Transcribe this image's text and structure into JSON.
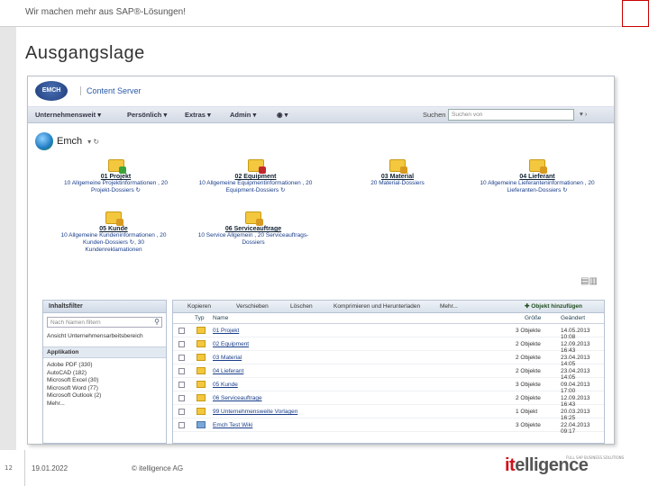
{
  "slide": {
    "tagline": "Wir machen mehr aus SAP®-Lösungen!",
    "title": "Ausgangslage"
  },
  "app": {
    "logo_text": "EMCH",
    "title": "Content Server",
    "menu": [
      "Unternehmensweit",
      "Persönlich",
      "Extras",
      "Admin"
    ],
    "menu_arrows": [
      "▾",
      "▾",
      "▾",
      "▾"
    ],
    "help_icon": "◉ ▾",
    "search_label": "Suchen",
    "search_placeholder": "Suchen von",
    "search_nav": "▾ ›"
  },
  "breadcrumb": {
    "label": "Emch",
    "arrows": "▾ ↻"
  },
  "folders": [
    {
      "name": "01 Projekt",
      "sub": "10 Allgemeine Projektinformationen , 20 Projekt-Dossiers ↻",
      "color": "#3aa33a"
    },
    {
      "name": "02 Equipment",
      "sub": "10 Allgemeine Equipmentinformationen , 20 Equipment-Dossiers ↻",
      "color": "#c0272d"
    },
    {
      "name": "03 Material",
      "sub": "20 Material-Dossiers",
      "color": "#d99a20"
    },
    {
      "name": "04 Lieferant",
      "sub": "10 Allgemeine Lieferanteninformationen , 20 Lieferanten-Dossiers ↻",
      "color": "#d99a20"
    },
    {
      "name": "05 Kunde",
      "sub": "10 Allgemeine Kundeninformationen , 20 Kunden-Dossiers ↻, 30 Kundenreklamationen",
      "color": "#d99a20"
    },
    {
      "name": "06 Serviceauftrage",
      "sub": "10 Service Allgemein , 20 Serviceauftrags-Dossiers",
      "color": "#d99a20"
    }
  ],
  "filter_pane": {
    "title": "Inhaltsfilter",
    "placeholder": "Nach Namen filtern",
    "scope": "Ansicht Unternehmensarbeitsbereich",
    "section": "Applikation",
    "apps": [
      "Adobe PDF (330)",
      "AutoCAD (182)",
      "Microsoft Excel (30)",
      "Microsoft Word (77)",
      "Microsoft Outlook (2)"
    ],
    "more": "Mehr..."
  },
  "toolbar": {
    "items": [
      "Kopieren",
      "Verschieben",
      "Löschen",
      "Komprimieren und Herunterladen",
      "Mehr..."
    ],
    "add": "Objekt hinzufügen"
  },
  "grid": {
    "headers": [
      "Typ",
      "Name",
      "Größe",
      "Geändert"
    ],
    "rows": [
      {
        "name": "01 Projekt",
        "size": "3 Objekte",
        "date": "14.05.2013 10:08"
      },
      {
        "name": "02 Equipment",
        "size": "2 Objekte",
        "date": "12.09.2013 16:43"
      },
      {
        "name": "03 Material",
        "size": "2 Objekte",
        "date": "23.04.2013 14:05"
      },
      {
        "name": "04 Lieferant",
        "size": "2 Objekte",
        "date": "23.04.2013 14:05"
      },
      {
        "name": "05 Kunde",
        "size": "3 Objekte",
        "date": "09.04.2013 17:00"
      },
      {
        "name": "06 Serviceauftrage",
        "size": "2 Objekte",
        "date": "12.09.2013 16:43"
      },
      {
        "name": "99 Unternehmensweite Vorlagen",
        "size": "1 Objekt",
        "date": "20.03.2013 16:25"
      },
      {
        "name": "Emch Test Wiki",
        "size": "3 Objekte",
        "date": "22.04.2013 09:17"
      }
    ]
  },
  "footer": {
    "page": "12",
    "date": "19.01.2022",
    "copyright": "© itelligence AG",
    "logo_prefix": "it",
    "logo_suffix": "elligence",
    "logo_tag": "FULL SAP BUSINESS SOLUTIONS"
  }
}
